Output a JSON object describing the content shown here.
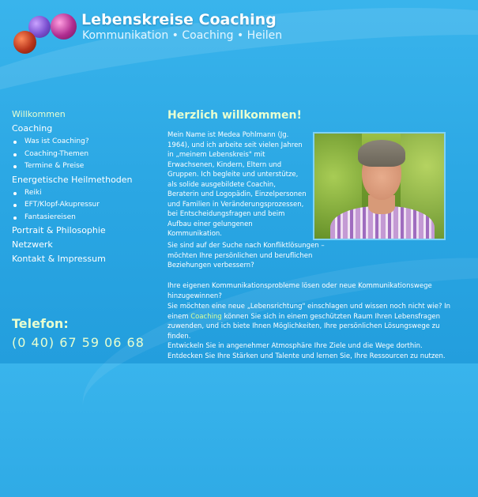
{
  "header": {
    "title": "Lebenskreise Coaching",
    "subtitle": "Kommunikation • Coaching • Heilen"
  },
  "nav": {
    "items": [
      {
        "label": "Willkommen"
      },
      {
        "label": "Coaching",
        "children": [
          "Was ist Coaching?",
          "Coaching-Themen",
          "Termine & Preise"
        ]
      },
      {
        "label": "Energetische Heilmethoden",
        "children": [
          "Reiki",
          "EFT/Klopf-Akupressur",
          "Fantasiereisen"
        ]
      },
      {
        "label": "Portrait & Philosophie"
      },
      {
        "label": "Netzwerk"
      },
      {
        "label": "Kontakt & Impressum"
      }
    ]
  },
  "contact": {
    "phone_label": "Telefon:",
    "phone_number": "(0 40) 67 59 06 68"
  },
  "main": {
    "headline": "Herzlich willkommen!",
    "intro": "Mein Name ist Medea Pohlmann (Jg. 1964), und ich arbeite seit vielen Jahren in „meinem Lebenskreis\" mit Erwachsenen, Kindern, Eltern und Gruppen. Ich begleite und unterstütze, als solide ausgebildete Coachin, Beraterin und Logopädin, Einzelpersonen und Familien in Veränderungsprozessen, bei Entscheidungsfragen und beim Aufbau einer gelungenen Kommunikation.",
    "paragraph2": "Sie sind auf der Suche nach Konfliktlösungen – möchten Ihre persönlichen und beruflichen Beziehungen verbessern?",
    "paragraph3": "Ihre eigenen Kommunikationsprobleme lösen oder neue Kommunikationswege hinzugewinnen?",
    "paragraph4_before": "Sie möchten eine neue „Lebensrichtung\" einschlagen und wissen noch nicht wie? In einem ",
    "paragraph4_link": "Coaching",
    "paragraph4_after": " können Sie sich in einem geschützten Raum Ihren Lebensfragen zuwenden, und ich biete Ihnen Möglichkeiten, Ihre persönlichen Lösungswege zu finden.",
    "paragraph5": "Entwickeln Sie in angenehmer Atmosphäre Ihre Ziele und die Wege dorthin. Entdecken Sie Ihre Stärken und Talente und lernen Sie, Ihre Ressourcen zu nutzen."
  }
}
